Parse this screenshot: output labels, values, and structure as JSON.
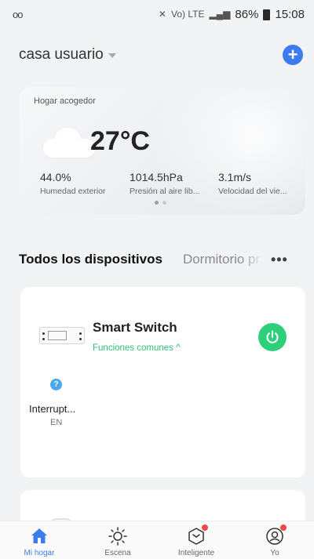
{
  "status_bar": {
    "left_icon": "voicemail-icon",
    "carrier_text": "Vo) LTE",
    "battery": "86%",
    "time": "15:08"
  },
  "header": {
    "home_name": "casa usuario",
    "add_icon": "plus-icon"
  },
  "weather": {
    "title": "Hogar acogedor",
    "icon": "cloud-icon",
    "temperature": "27°C",
    "stats": [
      {
        "value": "44.0%",
        "label": "Humedad exterior"
      },
      {
        "value": "1014.5hPa",
        "label": "Presión al aire lib..."
      },
      {
        "value": "3.1m/s",
        "label": "Velocidad del vie..."
      }
    ],
    "page_count": 2,
    "active_page": 1
  },
  "tabs": {
    "active": "Todos los dispositivos",
    "other": "Dormitorio pr",
    "more_icon": "more-icon"
  },
  "device": {
    "name": "Smart Switch",
    "subtitle": "Funciones comunes ^",
    "power_on": true,
    "power_color": "#2ecf7a",
    "sub_device_name": "Interrupt...",
    "sub_device_status": "EN"
  },
  "bottom_nav": [
    {
      "label": "Mi hogar",
      "icon": "home-icon",
      "active": true
    },
    {
      "label": "Escena",
      "icon": "sun-icon",
      "active": false
    },
    {
      "label": "Inteligente",
      "icon": "smart-icon",
      "active": false,
      "badge": true
    },
    {
      "label": "Yo",
      "icon": "profile-icon",
      "active": false,
      "badge": true
    }
  ],
  "colors": {
    "accent": "#3d7cf0",
    "green": "#2ecf7a",
    "badge_red": "#f04848"
  }
}
